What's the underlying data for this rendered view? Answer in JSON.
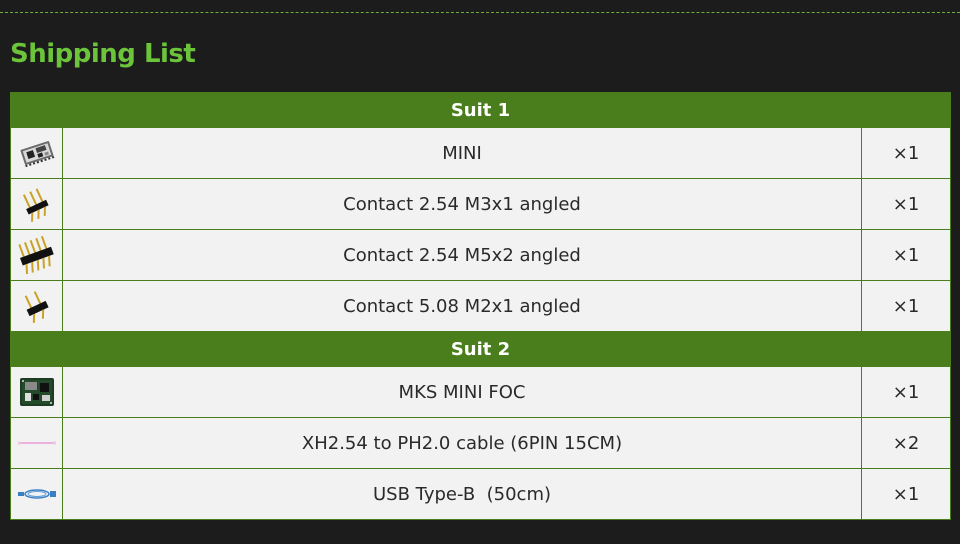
{
  "title": "Shipping List",
  "colors": {
    "background": "#1c1c1c",
    "title": "#6bc43a",
    "suit_header": "#4a7e1c",
    "row_background": "#f2f2f2",
    "border": "#4a7e1c"
  },
  "suits": [
    {
      "label": "Suit 1",
      "items": [
        {
          "icon": "mini-board-icon",
          "name": "MINI",
          "qty": "×1"
        },
        {
          "icon": "pin-header-3x1-icon",
          "name": "Contact 2.54 M3x1 angled",
          "qty": "×1"
        },
        {
          "icon": "pin-header-5x2-icon",
          "name": "Contact 2.54 M5x2 angled",
          "qty": "×1"
        },
        {
          "icon": "pin-header-2x1-icon",
          "name": "Contact 5.08 M2x1 angled",
          "qty": "×1"
        }
      ]
    },
    {
      "label": "Suit 2",
      "items": [
        {
          "icon": "foc-board-icon",
          "name": "MKS MINI FOC",
          "qty": "×1"
        },
        {
          "icon": "cable-icon",
          "name": "XH2.54 to PH2.0 cable (6PIN 15CM)",
          "qty": "×2"
        },
        {
          "icon": "usb-cable-icon",
          "name": "USB Type-B  (50cm)",
          "qty": "×1"
        }
      ]
    }
  ]
}
